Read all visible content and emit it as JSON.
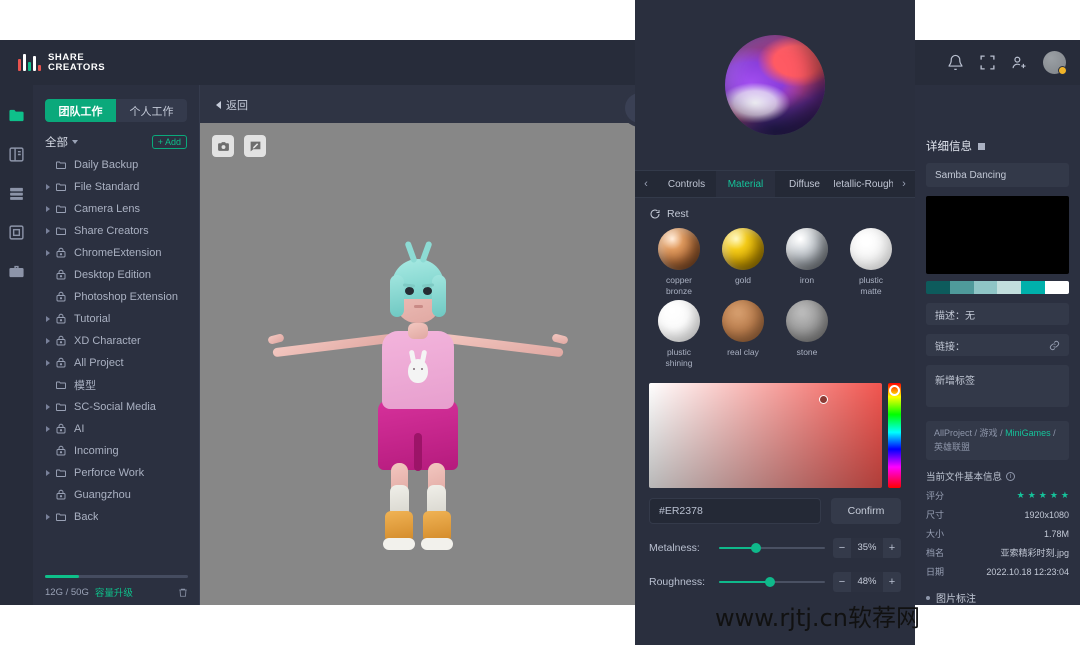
{
  "brand": {
    "line1": "SHARE",
    "line2": "CREATORS"
  },
  "header": {
    "icons": [
      "bell-icon",
      "fullscreen-icon",
      "add-user-icon"
    ],
    "avatar": "user-avatar"
  },
  "rail": {
    "items": [
      {
        "name": "folder",
        "active": true
      },
      {
        "name": "dashboard",
        "active": false
      },
      {
        "name": "archive",
        "active": false
      },
      {
        "name": "grid",
        "active": false
      },
      {
        "name": "briefcase",
        "active": false
      }
    ]
  },
  "sidebar": {
    "tabs": [
      {
        "label": "团队工作",
        "active": true
      },
      {
        "label": "个人工作",
        "active": false
      }
    ],
    "all_label": "全部",
    "add_label": "+ Add",
    "tree": [
      {
        "label": "Daily Backup",
        "icon": "folder-icon",
        "expandable": false
      },
      {
        "label": "File Standard",
        "icon": "folder-icon",
        "expandable": true
      },
      {
        "label": "Camera Lens",
        "icon": "folder-icon",
        "expandable": true
      },
      {
        "label": "Share Creators",
        "icon": "folder-icon",
        "expandable": true
      },
      {
        "label": "ChromeExtension",
        "icon": "lock-folder-icon",
        "expandable": true
      },
      {
        "label": "Desktop Edition",
        "icon": "lock-folder-icon",
        "expandable": false
      },
      {
        "label": "Photoshop Extension",
        "icon": "lock-folder-icon",
        "expandable": false
      },
      {
        "label": "Tutorial",
        "icon": "lock-folder-icon",
        "expandable": true
      },
      {
        "label": "XD Character",
        "icon": "lock-folder-icon",
        "expandable": true
      },
      {
        "label": "All Project",
        "icon": "lock-folder-icon",
        "expandable": true
      },
      {
        "label": "模型",
        "icon": "folder-icon",
        "expandable": false
      },
      {
        "label": "SC-Social Media",
        "icon": "folder-icon",
        "expandable": true
      },
      {
        "label": "AI",
        "icon": "lock-folder-icon",
        "expandable": true
      },
      {
        "label": "Incoming",
        "icon": "lock-folder-icon",
        "expandable": false
      },
      {
        "label": "Perforce Work",
        "icon": "folder-icon",
        "expandable": true
      },
      {
        "label": "Guangzhou",
        "icon": "lock-folder-icon",
        "expandable": false
      },
      {
        "label": "Back",
        "icon": "folder-icon",
        "expandable": true
      }
    ],
    "storage": {
      "used_total": "12G / 50G",
      "upgrade_label": "容量升级",
      "percent": 24
    }
  },
  "viewer": {
    "back_label": "返回",
    "tools": [
      {
        "name": "camera-icon"
      },
      {
        "name": "annotate-icon"
      }
    ],
    "expand_icon": "chevron-right-icon"
  },
  "material_panel": {
    "preview_sphere": "material-preview-sphere",
    "tabs": [
      {
        "label": "Controls",
        "active": false
      },
      {
        "label": "Material",
        "active": true
      },
      {
        "label": "Diffuse",
        "active": false
      },
      {
        "label": "Metallic-Roughn",
        "active": false
      }
    ],
    "prev_arrow": "‹",
    "next_arrow": "›",
    "reset_label": "Rest",
    "materials": [
      {
        "label": "copper\nbronze",
        "swatch": "b-copper"
      },
      {
        "label": "gold",
        "swatch": "b-gold"
      },
      {
        "label": "iron",
        "swatch": "b-iron"
      },
      {
        "label": "plustic\nmatte",
        "swatch": "b-pmatte"
      },
      {
        "label": "plustic\nshining",
        "swatch": "b-pshine"
      },
      {
        "label": "real clay",
        "swatch": "b-clay"
      },
      {
        "label": "stone",
        "swatch": "b-stone"
      }
    ],
    "color": {
      "hex_value": "#ER2378",
      "confirm_label": "Confirm",
      "sat_handle_x_pct": 73,
      "sat_handle_y_pct": 12,
      "hue_handle_y_pct": 2
    },
    "sliders": [
      {
        "label": "Metalness:",
        "value": "35%",
        "percent": 35,
        "minus": "−",
        "plus": "+"
      },
      {
        "label": "Roughness:",
        "value": "48%",
        "percent": 48,
        "minus": "−",
        "plus": "+"
      }
    ]
  },
  "detail": {
    "title": "详细信息",
    "asset_name": "Samba Dancing",
    "palette": [
      "#0d5b5c",
      "#4f9a9b",
      "#8fc5c6",
      "#c2dedd",
      "#00b0ab",
      "#ffffff"
    ],
    "description_label": "描述：无",
    "link_label": "链接：",
    "tag_placeholder": "新增标签",
    "breadcrumb": {
      "parts": [
        "AllProject",
        "游戏",
        "MiniGames",
        "英雄联盟"
      ],
      "highlight": "MiniGames",
      "text": "AllProject / 游戏 / MiniGames / 英雄联盟"
    },
    "basic_title": "当前文件基本信息",
    "rows": [
      {
        "key": "评分",
        "value": "★★★★★",
        "is_stars": true
      },
      {
        "key": "尺寸",
        "value": "1920x1080"
      },
      {
        "key": "大小",
        "value": "1.78M"
      },
      {
        "key": "档名",
        "value": "亚索精彩时刻.jpg"
      },
      {
        "key": "日期",
        "value": "2022.10.18 12:23:04"
      }
    ],
    "annotation_label": "图片标注"
  },
  "watermark": {
    "text": "www.rjtj.cn软荐网"
  },
  "colors": {
    "accent": "#0ec08a",
    "accent_dark": "#0aa97b",
    "tab_active": "#15c39a",
    "panel_bg": "#2b3040",
    "header_bg": "#272c3a",
    "material_bg": "#2a2f3e",
    "stage_bg": "#878787"
  }
}
